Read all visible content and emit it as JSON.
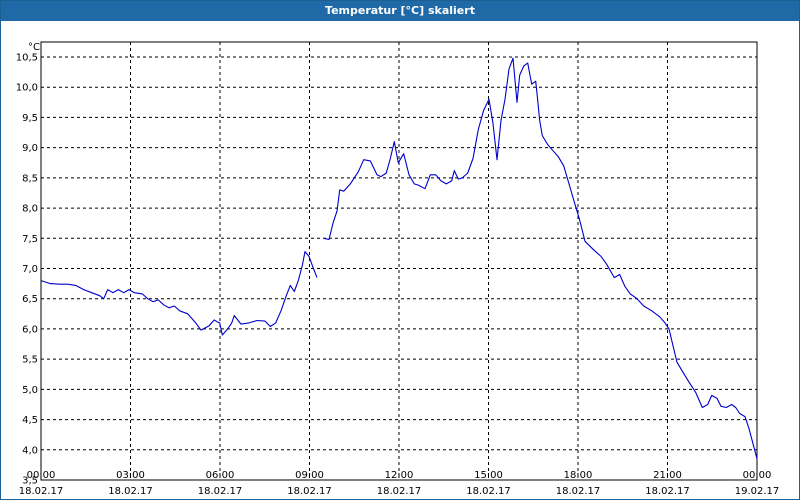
{
  "window": {
    "title": "Temperatur [°C] skaliert"
  },
  "colors": {
    "titlebar": "#1f6aa6",
    "line": "#0000cc",
    "grid": "#000000",
    "background": "#ffffff"
  },
  "chart_data": {
    "type": "line",
    "title": "Temperatur [°C] skaliert",
    "ylabel": "°C",
    "ylim": [
      3.5,
      10.5
    ],
    "yticks": [
      "3,5",
      "4,0",
      "4,5",
      "5,0",
      "5,5",
      "6,0",
      "6,5",
      "7,0",
      "7,5",
      "8,0",
      "8,5",
      "9,0",
      "9,5",
      "10,0",
      "10,5"
    ],
    "xlim": [
      0,
      24
    ],
    "xticks": [
      {
        "time": "00:00",
        "date": "18.02.17"
      },
      {
        "time": "03:00",
        "date": "18.02.17"
      },
      {
        "time": "06:00",
        "date": "18.02.17"
      },
      {
        "time": "09:00",
        "date": "18.02.17"
      },
      {
        "time": "12:00",
        "date": "18.02.17"
      },
      {
        "time": "15:00",
        "date": "18.02.17"
      },
      {
        "time": "18:00",
        "date": "18.02.17"
      },
      {
        "time": "21:00",
        "date": "18.02.17"
      },
      {
        "time": "00:00",
        "date": "19.02.17"
      }
    ],
    "grid": true,
    "legend": "none",
    "x_unit": "hours",
    "series": [
      {
        "segments": [
          [
            [
              0.0,
              6.8
            ],
            [
              0.35,
              6.75
            ],
            [
              0.7,
              6.74
            ],
            [
              1.0,
              6.74
            ],
            [
              1.3,
              6.72
            ],
            [
              1.6,
              6.65
            ],
            [
              1.9,
              6.6
            ],
            [
              2.2,
              6.55
            ],
            [
              2.35,
              6.5
            ],
            [
              2.5,
              6.65
            ],
            [
              2.7,
              6.6
            ],
            [
              2.9,
              6.65
            ],
            [
              3.1,
              6.6
            ],
            [
              3.3,
              6.65
            ],
            [
              3.5,
              6.6
            ],
            [
              3.8,
              6.58
            ],
            [
              4.0,
              6.5
            ],
            [
              4.2,
              6.45
            ],
            [
              4.4,
              6.48
            ],
            [
              4.6,
              6.4
            ],
            [
              4.8,
              6.35
            ],
            [
              5.0,
              6.38
            ],
            [
              5.2,
              6.3
            ],
            [
              5.5,
              6.25
            ],
            [
              5.8,
              6.1
            ],
            [
              6.0,
              5.98
            ],
            [
              6.3,
              6.05
            ],
            [
              6.5,
              6.15
            ],
            [
              6.6,
              6.12
            ],
            [
              6.7,
              6.1
            ],
            [
              6.8,
              5.9
            ],
            [
              7.0,
              6.0
            ],
            [
              7.15,
              6.1
            ],
            [
              7.25,
              6.22
            ],
            [
              7.5,
              6.08
            ],
            [
              7.8,
              6.1
            ],
            [
              8.1,
              6.14
            ],
            [
              8.4,
              6.13
            ],
            [
              8.6,
              6.04
            ],
            [
              8.8,
              6.1
            ],
            [
              9.0,
              6.3
            ],
            [
              9.2,
              6.55
            ],
            [
              9.35,
              6.72
            ],
            [
              9.5,
              6.62
            ],
            [
              9.65,
              6.8
            ],
            [
              9.8,
              7.05
            ],
            [
              9.9,
              7.28
            ],
            [
              10.05,
              7.2
            ],
            [
              10.2,
              7.02
            ],
            [
              10.35,
              6.85
            ]
          ],
          [
            [
              10.6,
              7.5
            ],
            [
              10.8,
              7.48
            ],
            [
              10.95,
              7.75
            ],
            [
              11.1,
              7.95
            ],
            [
              11.2,
              8.3
            ],
            [
              11.35,
              8.28
            ],
            [
              11.6,
              8.4
            ],
            [
              11.9,
              8.6
            ],
            [
              12.1,
              8.8
            ],
            [
              12.35,
              8.78
            ],
            [
              12.6,
              8.55
            ],
            [
              12.75,
              8.52
            ],
            [
              12.95,
              8.58
            ],
            [
              13.1,
              8.82
            ],
            [
              13.25,
              9.1
            ],
            [
              13.4,
              8.75
            ],
            [
              13.6,
              8.9
            ],
            [
              13.8,
              8.55
            ],
            [
              14.0,
              8.4
            ],
            [
              14.15,
              8.38
            ],
            [
              14.4,
              8.32
            ],
            [
              14.6,
              8.55
            ],
            [
              14.8,
              8.55
            ],
            [
              15.0,
              8.45
            ],
            [
              15.2,
              8.4
            ],
            [
              15.4,
              8.45
            ],
            [
              15.5,
              8.62
            ],
            [
              15.65,
              8.48
            ],
            [
              15.8,
              8.5
            ],
            [
              16.0,
              8.58
            ],
            [
              16.2,
              8.82
            ],
            [
              16.4,
              9.3
            ],
            [
              16.6,
              9.62
            ],
            [
              16.8,
              9.8
            ],
            [
              16.95,
              9.4
            ],
            [
              17.1,
              8.8
            ],
            [
              17.25,
              9.45
            ],
            [
              17.4,
              9.8
            ],
            [
              17.55,
              10.3
            ],
            [
              17.7,
              10.48
            ],
            [
              17.85,
              9.75
            ],
            [
              17.95,
              10.2
            ],
            [
              18.1,
              10.35
            ],
            [
              18.25,
              10.4
            ],
            [
              18.4,
              10.05
            ],
            [
              18.55,
              10.1
            ],
            [
              18.6,
              9.9
            ],
            [
              18.7,
              9.45
            ],
            [
              18.8,
              9.2
            ],
            [
              19.0,
              9.05
            ],
            [
              19.2,
              8.95
            ],
            [
              19.4,
              8.85
            ],
            [
              19.6,
              8.7
            ],
            [
              19.8,
              8.4
            ],
            [
              20.0,
              8.1
            ],
            [
              20.2,
              7.8
            ],
            [
              20.4,
              7.45
            ],
            [
              20.7,
              7.32
            ],
            [
              21.0,
              7.2
            ],
            [
              21.2,
              7.08
            ],
            [
              21.5,
              6.85
            ],
            [
              21.7,
              6.9
            ],
            [
              21.9,
              6.7
            ],
            [
              22.1,
              6.58
            ],
            [
              22.35,
              6.5
            ],
            [
              22.6,
              6.38
            ],
            [
              22.9,
              6.3
            ],
            [
              23.2,
              6.2
            ],
            [
              23.4,
              6.1
            ],
            [
              23.55,
              6.0
            ],
            [
              23.7,
              5.72
            ],
            [
              23.85,
              5.45
            ],
            [
              24.05,
              5.3
            ],
            [
              24.3,
              5.12
            ],
            [
              24.55,
              4.95
            ],
            [
              24.8,
              4.7
            ],
            [
              25.0,
              4.75
            ],
            [
              25.15,
              4.9
            ],
            [
              25.35,
              4.85
            ],
            [
              25.5,
              4.72
            ],
            [
              25.7,
              4.7
            ],
            [
              25.9,
              4.75
            ],
            [
              26.05,
              4.7
            ],
            [
              26.2,
              4.6
            ],
            [
              26.4,
              4.55
            ],
            [
              26.55,
              4.35
            ],
            [
              26.7,
              4.1
            ],
            [
              26.85,
              3.85
            ]
          ]
        ]
      }
    ]
  }
}
